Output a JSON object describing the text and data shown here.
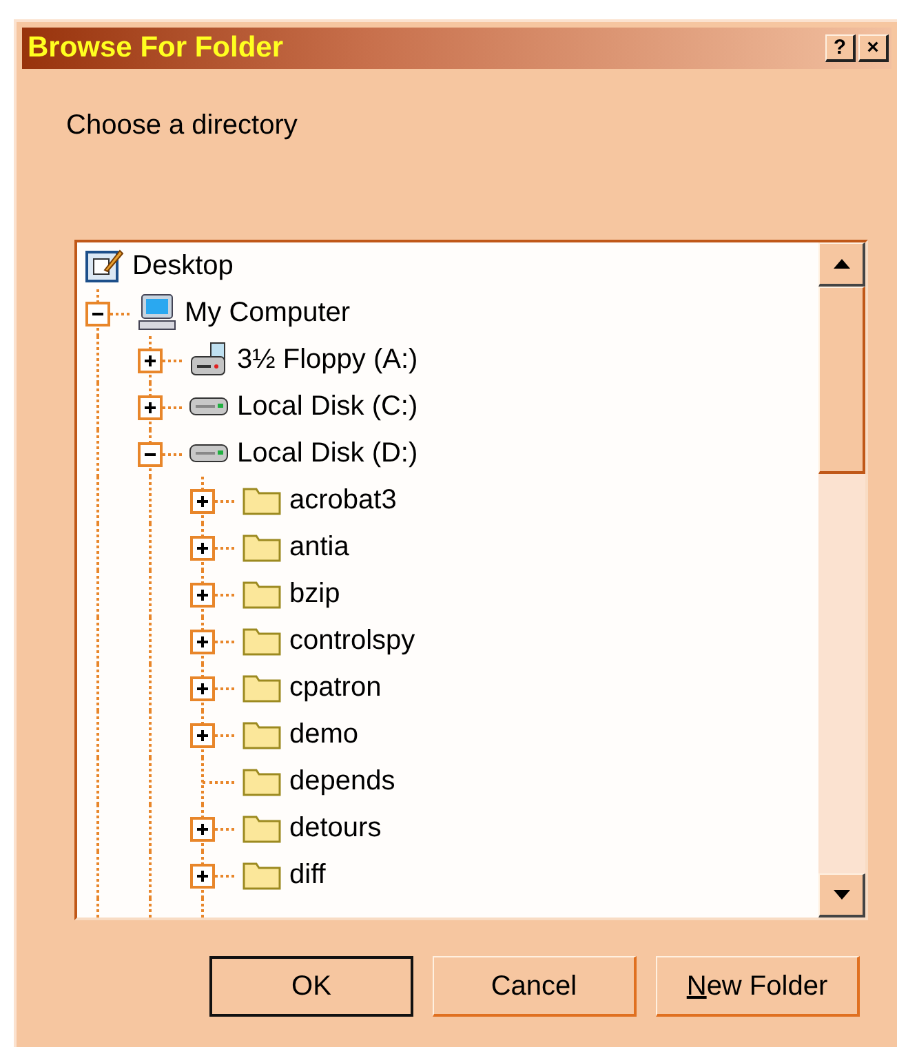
{
  "window": {
    "title": "Browse For Folder",
    "title_buttons": [
      "?",
      "×"
    ]
  },
  "prompt": "Choose a directory",
  "tree": [
    {
      "label": "Desktop",
      "kind": "desktop",
      "children": [
        {
          "label": "My Computer",
          "kind": "computer",
          "expandable": true,
          "expanded": true,
          "children": [
            {
              "label": "3½ Floppy (A:)",
              "kind": "floppy",
              "expandable": true,
              "expanded": false
            },
            {
              "label": "Local Disk (C:)",
              "kind": "disk",
              "expandable": true,
              "expanded": false
            },
            {
              "label": "Local Disk (D:)",
              "kind": "disk",
              "expandable": true,
              "expanded": true,
              "children": [
                {
                  "label": "acrobat3",
                  "kind": "folder",
                  "expandable": true,
                  "expanded": false
                },
                {
                  "label": "antia",
                  "kind": "folder",
                  "expandable": true,
                  "expanded": false
                },
                {
                  "label": "bzip",
                  "kind": "folder",
                  "expandable": true,
                  "expanded": false
                },
                {
                  "label": "controlspy",
                  "kind": "folder",
                  "expandable": true,
                  "expanded": false
                },
                {
                  "label": "cpatron",
                  "kind": "folder",
                  "expandable": true,
                  "expanded": false
                },
                {
                  "label": "demo",
                  "kind": "folder",
                  "expandable": true,
                  "expanded": false
                },
                {
                  "label": "depends",
                  "kind": "folder",
                  "expandable": false
                },
                {
                  "label": "detours",
                  "kind": "folder",
                  "expandable": true,
                  "expanded": false
                },
                {
                  "label": "diff",
                  "kind": "folder",
                  "expandable": true,
                  "expanded": false
                }
              ]
            }
          ]
        }
      ]
    }
  ],
  "buttons": [
    {
      "label": "OK",
      "default": true,
      "underline_first": false
    },
    {
      "label": "Cancel",
      "default": false,
      "underline_first": false
    },
    {
      "label": "New Folder",
      "default": false,
      "underline_first": true
    }
  ]
}
